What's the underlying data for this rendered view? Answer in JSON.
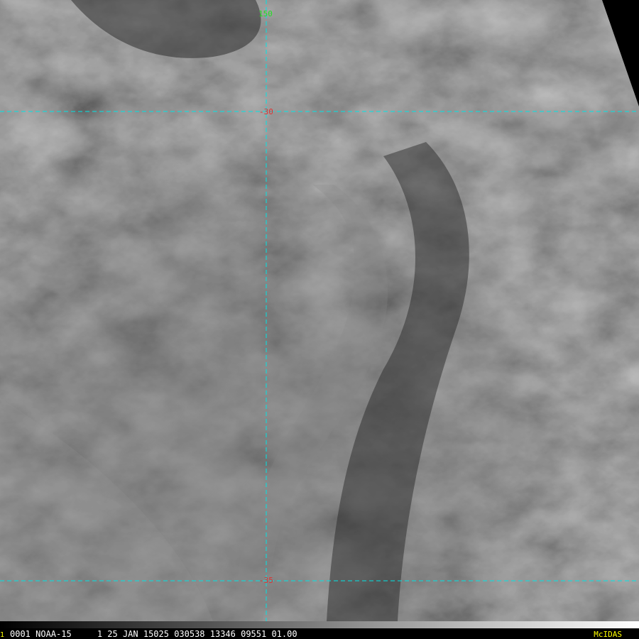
{
  "grid": {
    "line_color": "#00e5e5",
    "lon_label_color": "#22dd22",
    "lat_label_color": "#e03030",
    "lon_label": "150",
    "lat_label_top": "-30",
    "lat_label_bottom": "-35"
  },
  "status_bar": {
    "frame_number": "1",
    "text": "0001 NOAA-15     1 25 JAN 15025 030538 13346 09551 01.00",
    "brand": "McIDAS",
    "text_color": "#ffffff",
    "frame_color": "#ffff00",
    "brand_color": "#ffff00"
  },
  "imagery": {
    "satellite": "NOAA-15",
    "base_color": "#3a3a3a",
    "no_data_color": "#000000"
  }
}
